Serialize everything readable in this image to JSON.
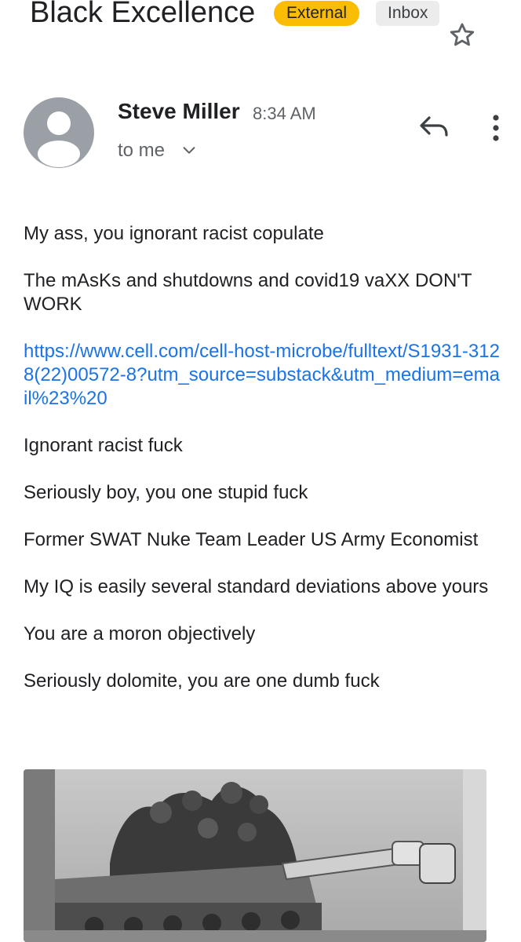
{
  "header": {
    "subject": "Black Excellence",
    "label_external": "External",
    "label_inbox": "Inbox"
  },
  "sender": {
    "name": "Steve Miller",
    "time": "8:34 AM",
    "recipient": "to me"
  },
  "body": {
    "paragraphs": [
      "My ass, you ignorant racist copulate",
      "The mAsKs and shutdowns and covid19 vaXX DON'T WORK",
      "https://www.cell.com/cell-host-microbe/fulltext/S1931-3128(22)00572-8?utm_source=substack&utm_medium=email%23%20",
      "Ignorant racist fuck",
      "Seriously boy, you one stupid fuck",
      "Former SWAT Nuke Team Leader US Army Economist",
      "My IQ is easily several standard deviations above yours",
      "You are a moron objectively",
      "Seriously dolomite, you are one dumb fuck"
    ]
  },
  "icons": {
    "star": "star-outline-icon",
    "avatar": "person-avatar-icon",
    "chevron": "chevron-down-icon",
    "reply": "reply-icon",
    "more": "more-vert-icon"
  },
  "colors": {
    "external_chip": "#fbbc04",
    "inbox_chip": "#ececec",
    "link": "#1a73e8",
    "avatar": "#9aa0a6"
  },
  "attachment": {
    "type": "photo",
    "description": "black-and-white photograph"
  }
}
